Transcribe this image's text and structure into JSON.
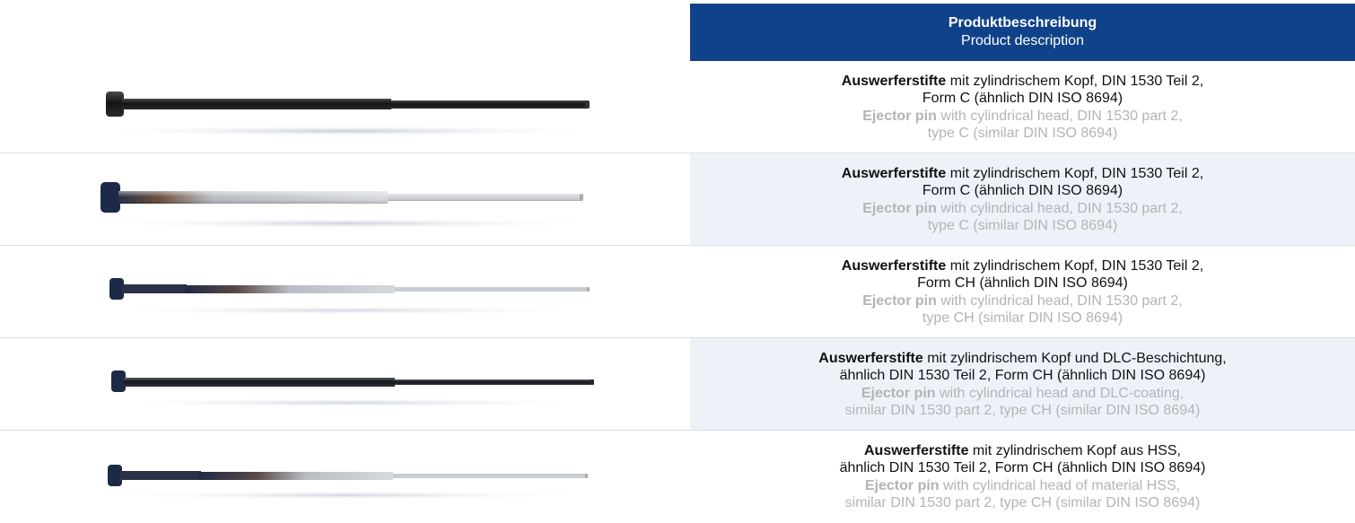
{
  "header": {
    "title_de": "Produktbeschreibung",
    "title_en": "Product description"
  },
  "rows": [
    {
      "de_bold": "Auswerferstifte",
      "de_line1": " mit zylindrischem Kopf, DIN 1530 Teil 2,",
      "de_line2": "Form C (ähnlich DIN ISO 8694)",
      "en_bold": "Ejector pin",
      "en_line1": " with cylindrical head, DIN 1530 part 2,",
      "en_line2": "type C (similar DIN ISO 8694)",
      "image": "ejector-pin-black"
    },
    {
      "de_bold": "Auswerferstifte",
      "de_line1": " mit zylindrischem Kopf, DIN 1530 Teil 2,",
      "de_line2": "Form C (ähnlich DIN ISO 8694)",
      "en_bold": "Ejector pin",
      "en_line1": " with cylindrical head, DIN 1530 part 2,",
      "en_line2": "type C (similar DIN ISO 8694)",
      "image": "ejector-pin-silver"
    },
    {
      "de_bold": "Auswerferstifte",
      "de_line1": " mit zylindrischem Kopf, DIN 1530 Teil 2,",
      "de_line2": "Form CH (ähnlich DIN ISO 8694)",
      "en_bold": "Ejector pin",
      "en_line1": " with cylindrical head, DIN 1530 part 2,",
      "en_line2": "type CH (similar DIN ISO 8694)",
      "image": "ejector-pin-stepped-silver"
    },
    {
      "de_bold": "Auswerferstifte",
      "de_line1": " mit zylindrischem Kopf und DLC-Beschichtung,",
      "de_line2": "ähnlich DIN 1530 Teil 2, Form CH (ähnlich DIN ISO 8694)",
      "en_bold": "Ejector pin",
      "en_line1": " with cylindrical head and DLC-coating,",
      "en_line2": "similar DIN 1530 part 2, type CH (similar DIN ISO 8694)",
      "image": "ejector-pin-dlc"
    },
    {
      "de_bold": "Auswerferstifte",
      "de_line1": " mit zylindrischem Kopf aus HSS,",
      "de_line2": "ähnlich DIN 1530 Teil 2, Form CH (ähnlich DIN ISO 8694)",
      "en_bold": "Ejector pin",
      "en_line1": " with cylindrical head of material HSS,",
      "en_line2": "similar DIN 1530 part 2, type CH (similar DIN ISO 8694)",
      "image": "ejector-pin-hss"
    }
  ],
  "colors": {
    "header_bg": "#0f4289",
    "alt_row_bg": "#eef2f8",
    "english_text": "#b4b4b4"
  }
}
